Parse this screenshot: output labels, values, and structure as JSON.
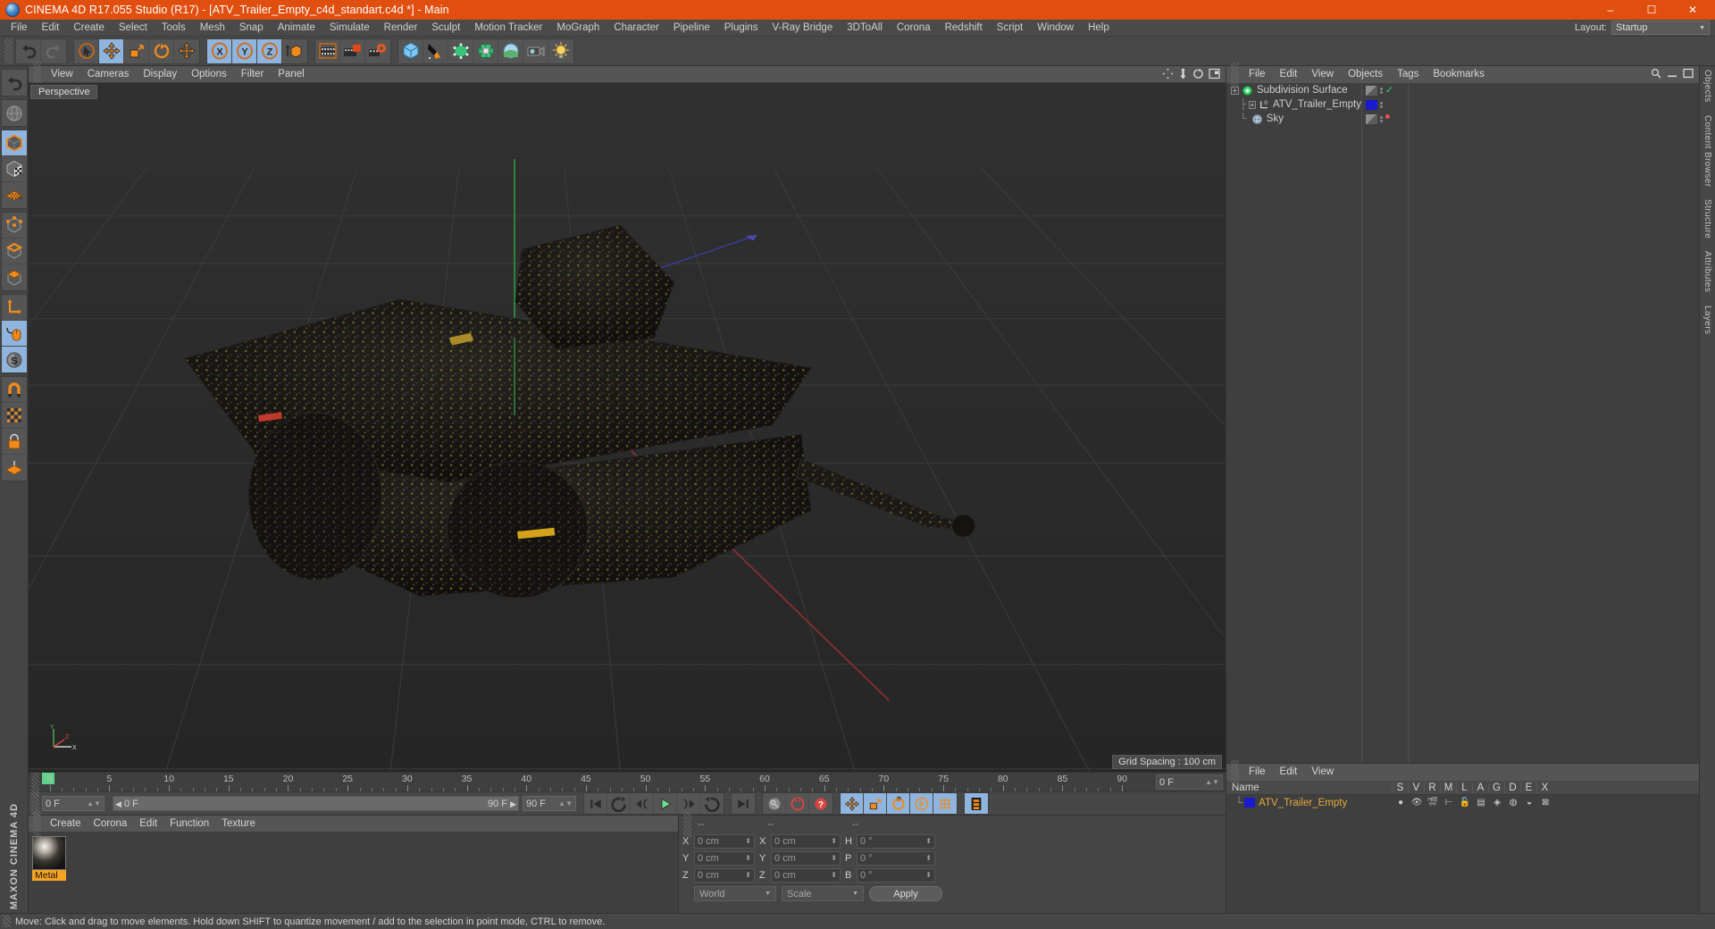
{
  "window": {
    "title": "CINEMA 4D R17.055 Studio (R17) - [ATV_Trailer_Empty_c4d_standart.c4d *] - Main",
    "minimize": "–",
    "maximize": "☐",
    "close": "✕"
  },
  "menubar": {
    "items": [
      "File",
      "Edit",
      "Create",
      "Select",
      "Tools",
      "Mesh",
      "Snap",
      "Animate",
      "Simulate",
      "Render",
      "Sculpt",
      "Motion Tracker",
      "MoGraph",
      "Character",
      "Pipeline",
      "Plugins",
      "V-Ray Bridge",
      "3DToAll",
      "Corona",
      "Redshift",
      "Script",
      "Window",
      "Help"
    ],
    "layout_label": "Layout:",
    "layout_value": "Startup"
  },
  "toolbar": {
    "groups": [
      {
        "name": "undo-redo",
        "buttons": [
          {
            "name": "undo-button",
            "icon": "undo-icon",
            "active": false
          },
          {
            "name": "redo-button",
            "icon": "redo-icon",
            "active": false
          }
        ]
      },
      {
        "name": "transform-tools",
        "buttons": [
          {
            "name": "live-selection-button",
            "icon": "cursor-select-icon",
            "active": false
          },
          {
            "name": "move-tool-button",
            "icon": "move-icon",
            "active": true
          },
          {
            "name": "scale-tool-button",
            "icon": "scale-icon",
            "active": false
          },
          {
            "name": "rotate-tool-button",
            "icon": "rotate-icon",
            "active": false
          },
          {
            "name": "move-axis-button",
            "icon": "move-plain-icon",
            "active": false
          }
        ]
      },
      {
        "name": "axis-locks",
        "buttons": [
          {
            "name": "x-axis-lock-button",
            "icon": "x-axis-icon",
            "active": true
          },
          {
            "name": "y-axis-lock-button",
            "icon": "y-axis-icon",
            "active": true
          },
          {
            "name": "z-axis-lock-button",
            "icon": "z-axis-icon",
            "active": true
          },
          {
            "name": "world-object-coord-button",
            "icon": "world-coord-icon",
            "active": false
          }
        ]
      },
      {
        "name": "render-tools",
        "buttons": [
          {
            "name": "render-view-button",
            "icon": "render-view-icon",
            "active": false
          },
          {
            "name": "render-to-picture-viewer-button",
            "icon": "render-picture-icon",
            "active": false
          },
          {
            "name": "render-settings-button",
            "icon": "render-settings-icon",
            "active": false
          }
        ]
      },
      {
        "name": "object-creation",
        "buttons": [
          {
            "name": "add-cube-button",
            "icon": "cube-icon",
            "active": false
          },
          {
            "name": "add-spline-button",
            "icon": "pen-icon",
            "active": false
          },
          {
            "name": "generators-button",
            "icon": "generator-icon",
            "active": false
          },
          {
            "name": "deformers-button",
            "icon": "deformer-icon",
            "active": false
          },
          {
            "name": "environment-button",
            "icon": "environment-icon",
            "active": false
          },
          {
            "name": "camera-button",
            "icon": "camera-icon",
            "active": false
          },
          {
            "name": "light-button",
            "icon": "light-icon",
            "active": false
          }
        ]
      }
    ]
  },
  "left_toolbar": {
    "groups": [
      {
        "name": "undo-group",
        "buttons": [
          {
            "name": "left-undo-button",
            "icon": "undo-small-icon",
            "active": false
          }
        ]
      },
      {
        "name": "world-group",
        "buttons": [
          {
            "name": "make-editable-button",
            "icon": "globe-icon",
            "active": false
          }
        ]
      },
      {
        "name": "mode-group",
        "buttons": [
          {
            "name": "model-mode-button",
            "icon": "model-cube-icon",
            "active": true
          },
          {
            "name": "texture-mode-button",
            "icon": "texture-cube-icon",
            "active": false
          },
          {
            "name": "uv-mode-button",
            "icon": "uv-mesh-icon",
            "active": false
          }
        ]
      },
      {
        "name": "component-group",
        "buttons": [
          {
            "name": "point-mode-button",
            "icon": "point-cube-icon",
            "active": false
          },
          {
            "name": "edge-mode-button",
            "icon": "edge-cube-icon",
            "active": false
          },
          {
            "name": "polygon-mode-button",
            "icon": "polygon-cube-icon",
            "active": false
          }
        ]
      },
      {
        "name": "axis-group",
        "buttons": [
          {
            "name": "enable-axis-button",
            "icon": "axis-corner-icon",
            "active": false
          },
          {
            "name": "viewport-solo-button",
            "icon": "mouse-icon",
            "active": true
          },
          {
            "name": "soft-selection-button",
            "icon": "soft-select-icon",
            "active": true
          }
        ]
      },
      {
        "name": "snap-group",
        "buttons": [
          {
            "name": "enable-snap-button",
            "icon": "magnet-icon",
            "active": false
          },
          {
            "name": "quantize-button",
            "icon": "quantize-grid-icon",
            "active": false
          },
          {
            "name": "lock-button",
            "icon": "lock-icon",
            "active": false
          },
          {
            "name": "workplane-button",
            "icon": "workplane-icon",
            "active": false
          }
        ]
      }
    ],
    "logo": "MAXON CINEMA 4D"
  },
  "viewport": {
    "menu": [
      "View",
      "Cameras",
      "Display",
      "Options",
      "Filter",
      "Panel"
    ],
    "tab_label": "Perspective",
    "grid_spacing": "Grid Spacing : 100 cm",
    "axis_labels": {
      "x": "X",
      "y": "Y",
      "z": "Z"
    },
    "corner_icons": [
      "pan-icon",
      "dolly-icon",
      "rotate-view-icon",
      "maximize-view-icon"
    ]
  },
  "timeline": {
    "ticks": [
      0,
      5,
      10,
      15,
      20,
      25,
      30,
      35,
      40,
      45,
      50,
      55,
      60,
      65,
      70,
      75,
      80,
      85,
      90
    ],
    "current_frame_field": "0 F",
    "left_field": "0 F",
    "range_start": "0 F",
    "range_end": "90 F",
    "end_field": "90 F"
  },
  "transport": {
    "buttons": [
      {
        "name": "go-to-start-button",
        "icon": "skip-start-icon",
        "active": false
      },
      {
        "name": "previous-keyframe-button",
        "icon": "prev-key-icon",
        "active": false
      },
      {
        "name": "step-back-button",
        "icon": "step-back-icon",
        "active": false
      },
      {
        "name": "play-button",
        "icon": "play-icon",
        "active": false
      },
      {
        "name": "step-forward-button",
        "icon": "step-forward-icon",
        "active": false
      },
      {
        "name": "next-keyframe-button",
        "icon": "next-key-icon",
        "active": false
      },
      {
        "name": "go-to-end-button",
        "icon": "skip-end-icon",
        "active": false
      },
      {
        "name": "record-active-objects-button",
        "icon": "key-icon",
        "active": false
      },
      {
        "name": "autokeying-button",
        "icon": "autokey-icon",
        "active": false
      },
      {
        "name": "keyframe-selection-button",
        "icon": "question-icon",
        "active": false
      },
      {
        "name": "position-key-button",
        "icon": "move-key-icon",
        "active": true
      },
      {
        "name": "scale-key-button",
        "icon": "scale-key-icon",
        "active": true
      },
      {
        "name": "rotation-key-button",
        "icon": "rotate-key-icon",
        "active": true
      },
      {
        "name": "parameter-key-button",
        "icon": "param-key-icon",
        "active": true
      },
      {
        "name": "point-level-animation-button",
        "icon": "pla-icon",
        "active": true
      },
      {
        "name": "timeline-view-button",
        "icon": "timeline-icon",
        "active": true
      }
    ]
  },
  "material_manager": {
    "menu": [
      "Create",
      "Corona",
      "Edit",
      "Function",
      "Texture"
    ],
    "materials": [
      {
        "name": "Metal",
        "selected": true
      }
    ]
  },
  "coordinates": {
    "headers": [
      "--",
      "--",
      "--"
    ],
    "rows": [
      {
        "label1": "X",
        "value1": "0 cm",
        "label2": "X",
        "value2": "0 cm",
        "label3": "H",
        "value3": "0 °"
      },
      {
        "label1": "Y",
        "value1": "0 cm",
        "label2": "Y",
        "value2": "0 cm",
        "label3": "P",
        "value3": "0 °"
      },
      {
        "label1": "Z",
        "value1": "0 cm",
        "label2": "Z",
        "value2": "0 cm",
        "label3": "B",
        "value3": "0 °"
      }
    ],
    "coord_system": "World",
    "mode": "Scale",
    "apply_label": "Apply"
  },
  "object_manager": {
    "menu": [
      "File",
      "Edit",
      "View",
      "Objects",
      "Tags",
      "Bookmarks"
    ],
    "objects": [
      {
        "name": "Subdivision Surface",
        "icon": "subdivision-surface-icon",
        "depth": 0,
        "expandable": true,
        "tag_color": "#777",
        "dot_state": "check"
      },
      {
        "name": "ATV_Trailer_Empty",
        "icon": "null-object-icon",
        "depth": 1,
        "expandable": true,
        "tag_color": "#1a1ad0",
        "dot_state": "none"
      },
      {
        "name": "Sky",
        "icon": "sky-icon",
        "depth": 1,
        "expandable": false,
        "tag_color": "#777",
        "dot_state": "red"
      }
    ]
  },
  "attribute_manager": {
    "menu": [
      "File",
      "Edit",
      "View"
    ],
    "columns": [
      "Name",
      "S",
      "V",
      "R",
      "M",
      "L",
      "A",
      "G",
      "D",
      "E",
      "X"
    ],
    "rows": [
      {
        "name": "ATV_Trailer_Empty",
        "swatch": "#1a1ad0"
      }
    ]
  },
  "right_dock": {
    "tabs": [
      "Objects",
      "Content Browser",
      "Structure",
      "Attributes",
      "Layers"
    ]
  },
  "status_bar": {
    "message": "Move: Click and drag to move elements. Hold down SHIFT to quantize movement / add to the selection in point mode, CTRL to remove."
  }
}
